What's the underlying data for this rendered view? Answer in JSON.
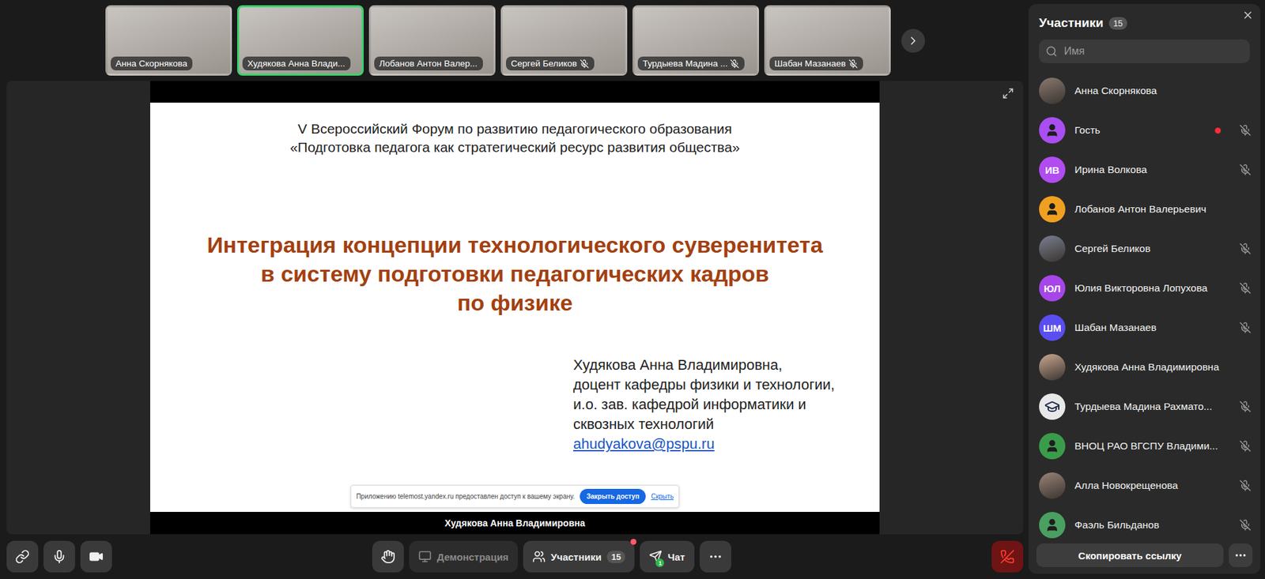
{
  "tiles": [
    {
      "name": "Анна Скорнякова",
      "muted": false,
      "speaking": false
    },
    {
      "name": "Худякова Анна Влади...",
      "muted": false,
      "speaking": true
    },
    {
      "name": "Лобанов Антон Валер...",
      "muted": false,
      "speaking": false
    },
    {
      "name": "Сергей Беликов",
      "muted": true,
      "speaking": false
    },
    {
      "name": "Турдыева Мадина ...",
      "muted": true,
      "speaking": false
    },
    {
      "name": "Шабан Мазанаев",
      "muted": true,
      "speaking": false
    }
  ],
  "slide": {
    "forum": [
      "V Всероссийский Форум по развитию педагогического образования",
      "«Подготовка педагога как стратегический ресурс развития общества»"
    ],
    "title": [
      "Интеграция концепции технологического суверенитета",
      "в систему подготовки педагогических кадров",
      "по физике"
    ],
    "author": [
      "Худякова Анна Владимировна,",
      "доцент кафедры физики и технологии,",
      "и.о. зав. кафедрой информатики и",
      "сквозных технологий"
    ],
    "email": "ahudyakova@pspu.ru"
  },
  "share_notice": {
    "text": "Приложению telemost.yandex.ru предоставлен доступ к вашему экрану.",
    "button": "Закрыть доступ",
    "link": "Скрыть"
  },
  "speaker_caption": "Худякова Анна Владимировна",
  "toolbar": {
    "demo": {
      "label": "Демонстрация",
      "disabled": true
    },
    "participants": {
      "label": "Участники",
      "count": "15",
      "alert": true
    },
    "chat": {
      "label": "Чат",
      "badge": "1"
    }
  },
  "panel": {
    "title": "Участники",
    "count": "15",
    "search_placeholder": "Имя",
    "participants": [
      {
        "name": "Анна Скорнякова",
        "kind": "photo",
        "initials": "",
        "color": "#8a7a70",
        "muted": false,
        "recording": false
      },
      {
        "name": "Гость",
        "kind": "person",
        "initials": "",
        "color": "#a94ef0",
        "muted": true,
        "recording": true
      },
      {
        "name": "Ирина Волкова",
        "kind": "initials",
        "initials": "ИВ",
        "color": "#b04cf0",
        "muted": true,
        "recording": false
      },
      {
        "name": "Лобанов Антон Валерьевич",
        "kind": "person",
        "initials": "",
        "color": "#f0a020",
        "muted": false,
        "recording": false
      },
      {
        "name": "Сергей Беликов",
        "kind": "photo",
        "initials": "",
        "color": "#7a8090",
        "muted": true,
        "recording": false
      },
      {
        "name": "Юлия Викторовна Лопухова",
        "kind": "initials",
        "initials": "ЮЛ",
        "color": "#a646e8",
        "muted": true,
        "recording": false
      },
      {
        "name": "Шабан Мазанаев",
        "kind": "initials",
        "initials": "ШМ",
        "color": "#5a4ef0",
        "muted": true,
        "recording": false
      },
      {
        "name": "Худякова Анна Владимировна",
        "kind": "photo",
        "initials": "",
        "color": "#c9a890",
        "muted": false,
        "recording": false
      },
      {
        "name": "Турдыева Мадина Рахмато...",
        "kind": "cap",
        "initials": "",
        "color": "#e8e8e8",
        "muted": true,
        "recording": false
      },
      {
        "name": "ВНОЦ РАО ВГСПУ Владими...",
        "kind": "person",
        "initials": "",
        "color": "#3a9c4a",
        "muted": true,
        "recording": false
      },
      {
        "name": "Алла Новокрещенова",
        "kind": "photo",
        "initials": "",
        "color": "#9a8478",
        "muted": true,
        "recording": false
      },
      {
        "name": "Фаэль Бильданов",
        "kind": "person",
        "initials": "",
        "color": "#4aa060",
        "muted": true,
        "recording": false
      }
    ],
    "copy_button": "Скопировать ссылку"
  }
}
